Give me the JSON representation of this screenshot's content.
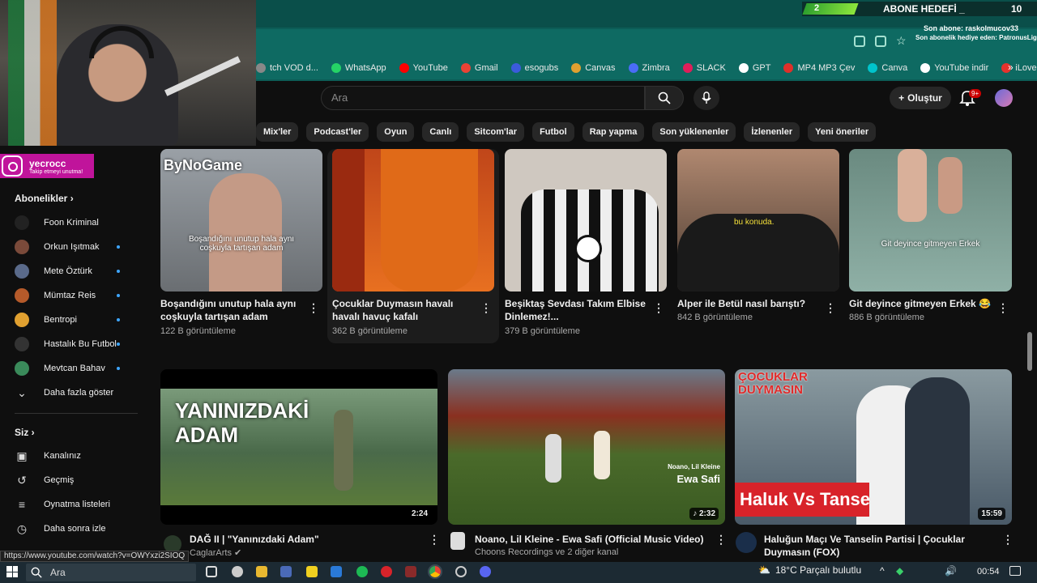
{
  "overlay": {
    "abone_count": "2",
    "abone_title": "ABONE HEDEFİ",
    "abone_sep": "_",
    "abone_goal": "10",
    "son_abone": "Son abone: raskolmucov33",
    "son_hediye": "Son abonelik hediye eden: PatronusLight",
    "instagram_name": "yecrocc",
    "instagram_sub": "Takip etmeyi unutma!"
  },
  "bookmarks": [
    "tch VOD d...",
    "WhatsApp",
    "YouTube",
    "Gmail",
    "esogubs",
    "Canvas",
    "Zimbra",
    "SLACK",
    "GPT",
    "MP4 MP3 Çev",
    "Canva",
    "YouTube indir",
    "iLovePDF"
  ],
  "bookmark_colors": [
    "#888",
    "#25d366",
    "#ff0000",
    "#ea4335",
    "#3b5bdb",
    "#e0a030",
    "#4a6cf7",
    "#e01e5a",
    "#ffffff",
    "#e0302a",
    "#00c4cc",
    "#ffffff",
    "#e5322d"
  ],
  "header": {
    "search_placeholder": "Ara",
    "create_label": "Oluştur",
    "notif_badge": "9+"
  },
  "chips": [
    "Mix'ler",
    "Podcast'ler",
    "Oyun",
    "Canlı",
    "Sitcom'lar",
    "Futbol",
    "Rap yapma",
    "Son yüklenenler",
    "İzlenenler",
    "Yeni öneriler"
  ],
  "sidebar": {
    "subs_heading": "Abonelikler",
    "subs": [
      {
        "name": "Foon Kriminal",
        "color": "#222",
        "live": false
      },
      {
        "name": "Orkun Işıtmak",
        "color": "#7a4a3a",
        "live": true
      },
      {
        "name": "Mete Öztürk",
        "color": "#5a6a8a",
        "live": true
      },
      {
        "name": "Mümtaz Reis",
        "color": "#b55a2a",
        "live": true
      },
      {
        "name": "Bentropi",
        "color": "#e0a030",
        "live": true
      },
      {
        "name": "Hastalık Bu Futbol",
        "color": "#333",
        "live": true
      },
      {
        "name": "Mevtcan Bahav",
        "color": "#3a8a5a",
        "live": true
      }
    ],
    "show_more": "Daha fazla göster",
    "you_heading": "Siz",
    "you_items": [
      "Kanalınız",
      "Geçmiş",
      "Oynatma listeleri",
      "Daha sonra izle"
    ]
  },
  "row1": [
    {
      "title": "Boşandığını unutup hala aynı coşkuyla tartışan adam",
      "meta": "122 B görüntüleme",
      "caption": "Boşandığını unutup hala aynı coşkuyla tartışan adam",
      "brand": "ByNoGame"
    },
    {
      "title": "Çocuklar Duymasın havalı havalı havuç kafalı",
      "meta": "362 B görüntüleme",
      "caption": ""
    },
    {
      "title": "Beşiktaş Sevdası Takım Elbise Dinlemez!...",
      "meta": "379 B görüntüleme",
      "caption": ""
    },
    {
      "title": "Alper ile Betül nasıl barıştı?",
      "meta": "842 B görüntüleme",
      "caption": "bu konuda."
    },
    {
      "title": "Git deyince gitmeyen Erkek 😂",
      "meta": "886 B görüntüleme",
      "caption": "Git deyince gitmeyen Erkek"
    }
  ],
  "row2": [
    {
      "title": "DAĞ II | \"Yanınızdaki Adam\"",
      "channel": "CaglarArts",
      "duration": "2:24",
      "overlay": "YANINIZDAKİ ADAM"
    },
    {
      "title": "Noano, Lil Kleine - Ewa Safi (Official Music Video)",
      "channel": "Choons Recordings ve 2 diğer kanal",
      "duration": "2:32",
      "overlay_small": "Noano, Lil Kleine",
      "overlay": "Ewa Safi"
    },
    {
      "title": "Haluğun Maçı Ve Tanselin Partisi | Çocuklar Duymasın (FOX)",
      "channel": "",
      "duration": "15:59",
      "overlay_top": "ÇOCUKLAR DUYMASIN",
      "overlay": "Haluk Vs Tansel"
    }
  ],
  "status_url": "https://www.youtube.com/watch?v=OWYxzi2SIOQ",
  "taskbar": {
    "search_label": "Ara",
    "weather": "18°C  Parçalı bulutlu",
    "time": "00:54"
  },
  "colors": {
    "accent": "#3ea6ff",
    "yt_red": "#ff0000",
    "insta": "#c0149b"
  }
}
